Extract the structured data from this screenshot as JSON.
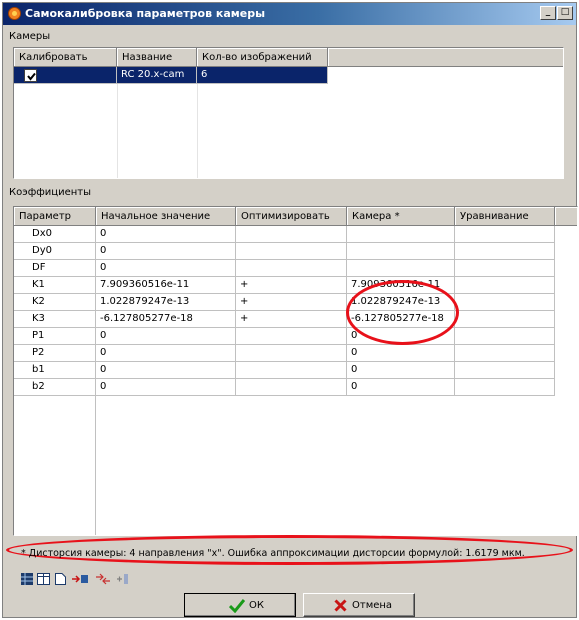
{
  "window": {
    "title": "Самокалибровка параметров камеры",
    "controls": {
      "minimize": "_",
      "maximize": "□",
      "close": "×"
    }
  },
  "cameras": {
    "label": "Камеры",
    "headers": [
      "Калибровать",
      "Название",
      "Кол-во изображений"
    ],
    "rows": [
      {
        "calibrate": true,
        "name": "RC 20.x-cam",
        "count": "6"
      }
    ]
  },
  "coefficients": {
    "label": "Коэффициенты",
    "headers": [
      "Параметр",
      "Начальное значение",
      "Оптимизировать",
      "Камера *",
      "Уравнивание"
    ],
    "rows": [
      [
        "Dx0",
        "0",
        "",
        "",
        ""
      ],
      [
        "Dy0",
        "0",
        "",
        "",
        ""
      ],
      [
        "DF",
        "0",
        "",
        "",
        ""
      ],
      [
        "K1",
        "7.909360516e-11",
        "+",
        "7.909360516e-11",
        ""
      ],
      [
        "K2",
        "1.022879247e-13",
        "+",
        "1.022879247e-13",
        ""
      ],
      [
        "K3",
        "-6.127805277e-18",
        "+",
        "-6.127805277e-18",
        ""
      ],
      [
        "P1",
        "0",
        "",
        "0",
        ""
      ],
      [
        "P2",
        "0",
        "",
        "0",
        ""
      ],
      [
        "b1",
        "0",
        "",
        "0",
        ""
      ],
      [
        "b2",
        "0",
        "",
        "0",
        ""
      ]
    ]
  },
  "status": {
    "text": "* Дисторсия камеры: 4 направления \"x\". Ошибка аппроксимации дисторсии формулой: 1.6179 мкм."
  },
  "toolbar": {
    "icons": [
      "table-icon",
      "columns-icon",
      "new-document-icon",
      "transfer-icon",
      "arrows-icon",
      "add-icon"
    ]
  },
  "buttons": {
    "ok_label": "ОК",
    "cancel_label": "Отмена"
  },
  "colors": {
    "selection": "#0a246a",
    "highlight_ring": "#e8111a",
    "ok_icon": "#1a9a1a",
    "cancel_icon": "#c81414"
  }
}
